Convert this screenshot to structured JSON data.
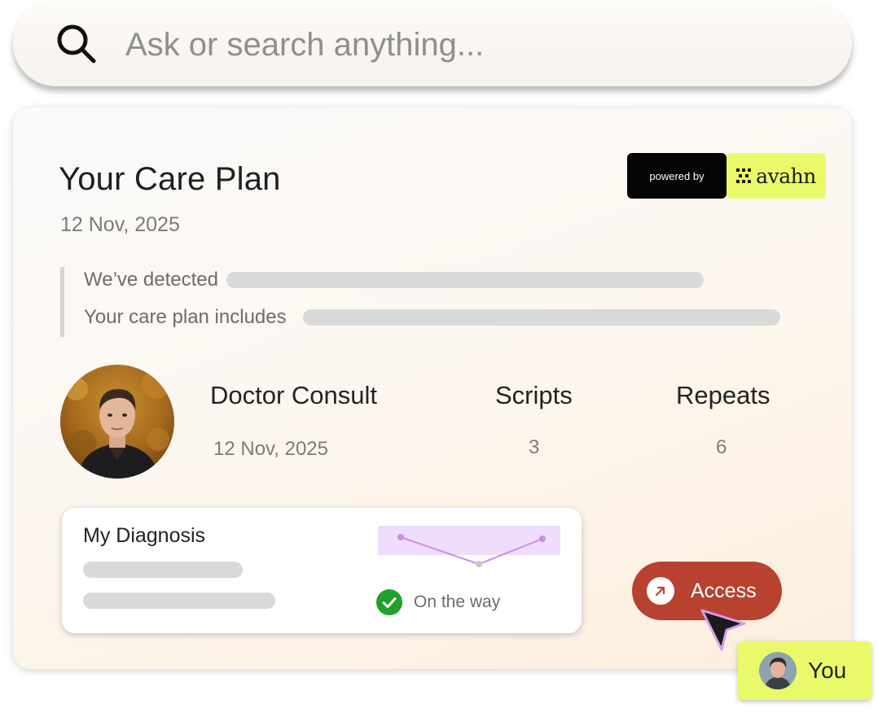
{
  "search": {
    "placeholder": "Ask or search anything..."
  },
  "card": {
    "title": "Your Care Plan",
    "date": "12 Nov, 2025",
    "powered_by": {
      "label": "powered by",
      "brand": "avahn",
      "brand_color": "#eaf96a"
    },
    "summary": {
      "detected_label": "We’ve detected",
      "includes_label": "Your care plan includes"
    },
    "consult": {
      "title": "Doctor Consult",
      "date": "12 Nov, 2025",
      "scripts_title": "Scripts",
      "scripts_value": "3",
      "repeats_title": "Repeats",
      "repeats_value": "6"
    },
    "diagnosis": {
      "title": "My Diagnosis",
      "status": "On the way",
      "status_color": "#1fa12b",
      "progress_points": [
        1,
        0,
        1
      ]
    },
    "access": {
      "label": "Access",
      "color": "#b94130",
      "icon": "arrow-up-right-icon"
    }
  },
  "cursor_tag": {
    "label": "You"
  }
}
